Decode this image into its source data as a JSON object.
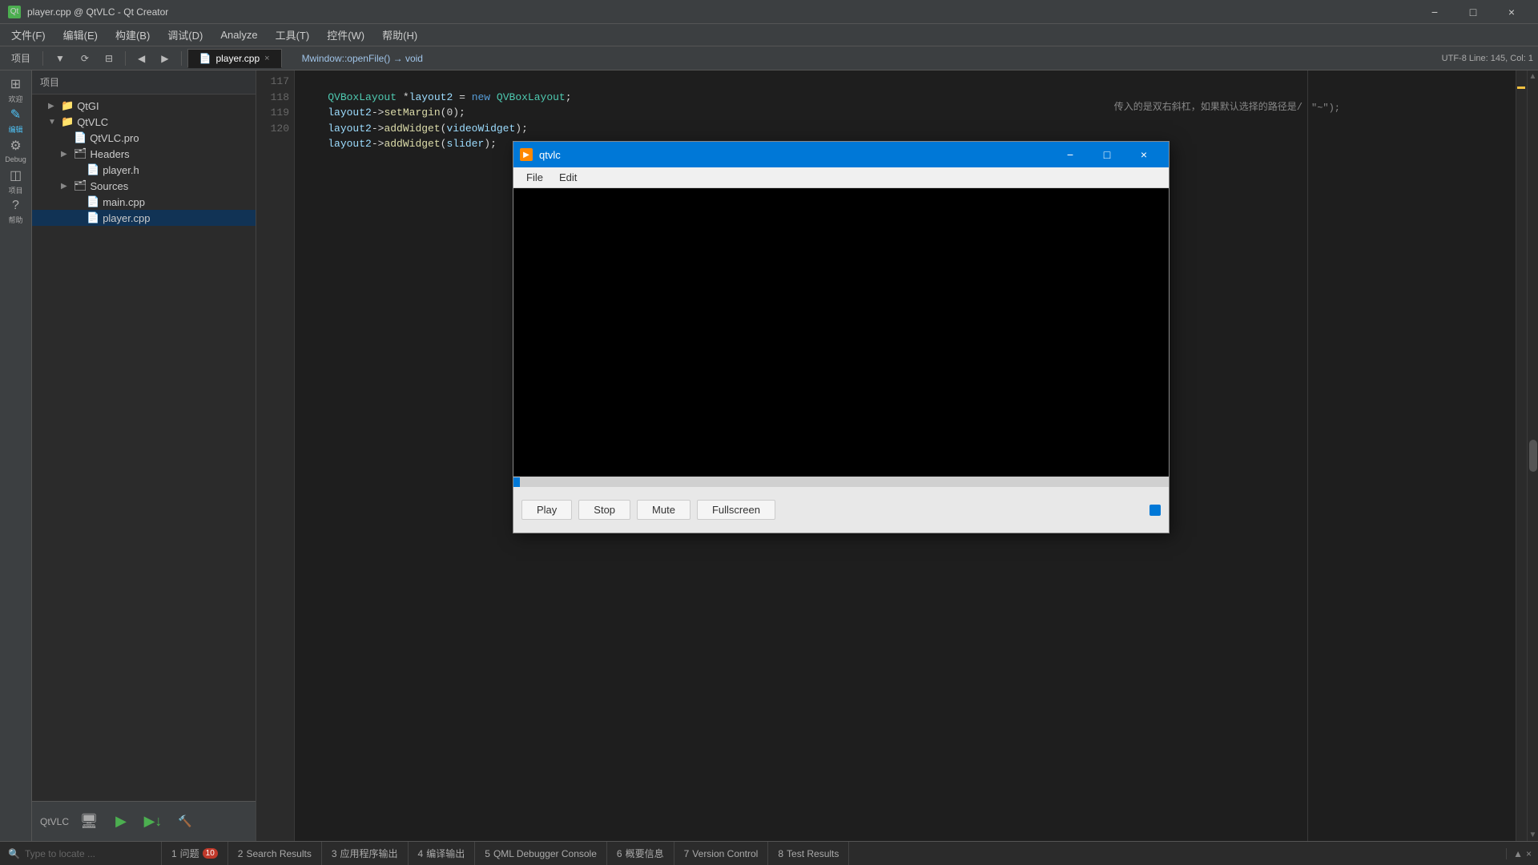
{
  "titlebar": {
    "title": "player.cpp @ QtVLC - Qt Creator",
    "minimize": "−",
    "maximize": "□",
    "close": "×"
  },
  "menubar": {
    "items": [
      "文件(F)",
      "编辑(E)",
      "构建(B)",
      "调试(D)",
      "Analyze",
      "工具(T)",
      "控件(W)",
      "帮助(H)"
    ]
  },
  "toolbar": {
    "project_label": "项目",
    "tab_label": "player.cpp",
    "breadcrumb": "Mwindow::openFile() → void",
    "status": "UTF-8  Line: 145, Col: 1"
  },
  "sidebar": {
    "icons": [
      {
        "name": "welcome-icon",
        "symbol": "⊞",
        "label": "欢迎"
      },
      {
        "name": "edit-icon",
        "symbol": "✎",
        "label": "编辑"
      },
      {
        "name": "debug-icon",
        "symbol": "⚙",
        "label": "Debug"
      },
      {
        "name": "project-icon",
        "symbol": "◫",
        "label": "项目"
      },
      {
        "name": "help-icon",
        "symbol": "?",
        "label": "帮助"
      }
    ]
  },
  "project_tree": {
    "header": "项目",
    "items": [
      {
        "id": "qtgi",
        "label": "QtGI",
        "indent": 1,
        "expand": "▶",
        "icon": "📁"
      },
      {
        "id": "qtvlc",
        "label": "QtVLC",
        "indent": 1,
        "expand": "▼",
        "icon": "📁"
      },
      {
        "id": "qtvlc-pro",
        "label": "QtVLC.pro",
        "indent": 2,
        "expand": "",
        "icon": "📄"
      },
      {
        "id": "headers",
        "label": "Headers",
        "indent": 2,
        "expand": "▶",
        "icon": "🗂"
      },
      {
        "id": "player-h",
        "label": "player.h",
        "indent": 3,
        "expand": "",
        "icon": "📄"
      },
      {
        "id": "sources",
        "label": "Sources",
        "indent": 2,
        "expand": "▶",
        "icon": "🗂"
      },
      {
        "id": "main-cpp",
        "label": "main.cpp",
        "indent": 3,
        "expand": "",
        "icon": "📄"
      },
      {
        "id": "player-cpp",
        "label": "player.cpp",
        "indent": 3,
        "expand": "",
        "icon": "📄",
        "selected": true
      }
    ]
  },
  "editor": {
    "tab": "player.cpp",
    "lines": [
      {
        "num": "117",
        "content": "    QVBoxLayout *layout2 = new QVBoxLayout;"
      },
      {
        "num": "118",
        "content": "    layout2->setMargin(0);"
      },
      {
        "num": "119",
        "content": "    layout2->addWidget(videoWidget);"
      },
      {
        "num": "120",
        "content": "    layout2->addWidget(slider);"
      }
    ],
    "right_comment": "\"~\");"
  },
  "qtvlc_window": {
    "title": "qtvlc",
    "menu": [
      "File",
      "Edit"
    ],
    "minimize": "−",
    "maximize": "□",
    "close": "×",
    "controls": {
      "play_label": "Play",
      "stop_label": "Stop",
      "mute_label": "Mute",
      "fullscreen_label": "Fullscreen"
    }
  },
  "bottom_bar": {
    "search_placeholder": "Type to locate ...",
    "tabs": [
      {
        "num": "1",
        "label": "问题",
        "badge": "10"
      },
      {
        "num": "2",
        "label": "Search Results"
      },
      {
        "num": "3",
        "label": "应用程序输出"
      },
      {
        "num": "4",
        "label": "编译输出"
      },
      {
        "num": "5",
        "label": "QML Debugger Console"
      },
      {
        "num": "6",
        "label": "概要信息"
      },
      {
        "num": "7",
        "label": "Version Control"
      },
      {
        "num": "8",
        "label": "Test Results"
      }
    ]
  },
  "side_bottom": {
    "kit_label": "QtVLC",
    "device_icon": "🖥",
    "run_icon": "▶",
    "build_icon": "🔨"
  },
  "right_panel_comment": "传入的是双右斜杠，如果默认选择的路径是/",
  "colors": {
    "accent": "#0078d7",
    "titlebar_bg": "#3c3f41",
    "editor_bg": "#1e1e1e",
    "sidebar_bg": "#2b2b2b",
    "qtvlc_title": "#0078d7"
  }
}
